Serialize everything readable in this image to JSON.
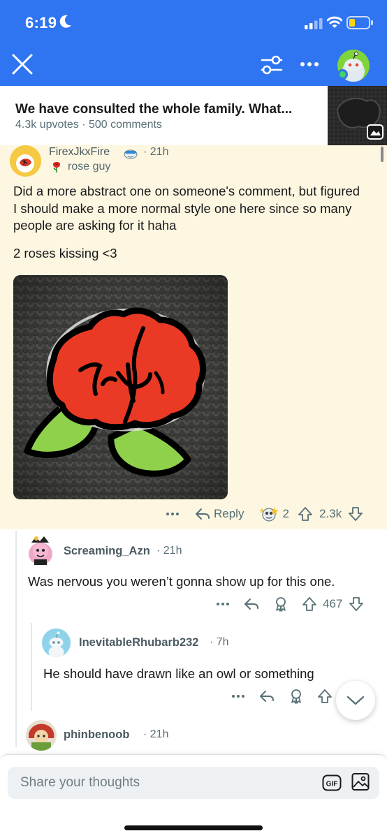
{
  "status_bar": {
    "time": "6:19",
    "icons": [
      "moon-icon",
      "cellular-signal-icon",
      "wifi-icon",
      "battery-icon"
    ]
  },
  "top_bar": {
    "icons": [
      "close-icon",
      "sort-icon",
      "more-icon",
      "avatar"
    ],
    "accent_color": "#2f74f0"
  },
  "post": {
    "title": "We have consulted the whole family. What...",
    "upvotes": "4.3k upvotes",
    "separator": "·",
    "comments": "500 comments"
  },
  "comments": [
    {
      "username": "FirexJkxFire",
      "time": "21h",
      "flair": "rose guy",
      "body_1": "Did a more abstract one on someone's comment, but figured I should make a more normal style one here since so many people are asking for it haha",
      "body_2": "2 roses kissing <3",
      "reply_label": "Reply",
      "award_count": "2",
      "score": "2.3k",
      "highlight_color": "#fdf6e1"
    },
    {
      "username": "Screaming_Azn",
      "time": "21h",
      "body": "Was nervous you weren’t gonna show up for this one.",
      "score": "467"
    },
    {
      "username": "InevitableRhubarb232",
      "time": "7h",
      "body": "He should have drawn like an owl or something"
    },
    {
      "username": "phinbenoob",
      "time": "21h"
    }
  ],
  "composer": {
    "placeholder": "Share your thoughts",
    "gif_label": "GIF"
  }
}
